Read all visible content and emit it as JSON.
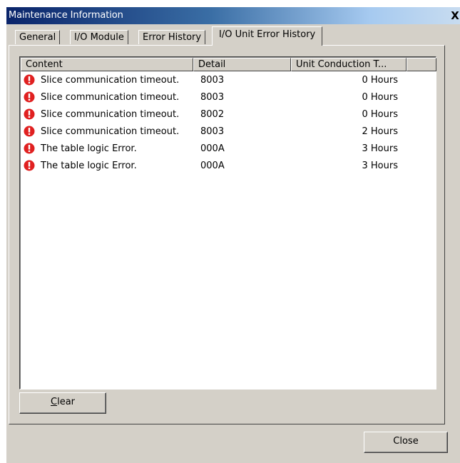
{
  "window": {
    "title": "Maintenance Information",
    "close_glyph": "X"
  },
  "tabs": [
    {
      "label": "General",
      "active": false
    },
    {
      "label": "I/O Module",
      "active": false
    },
    {
      "label": "Error History",
      "active": false
    },
    {
      "label": "I/O Unit Error History",
      "active": true
    }
  ],
  "table": {
    "columns": [
      "Content",
      "Detail",
      "Unit Conduction T..."
    ],
    "rows": [
      {
        "icon": "error-icon",
        "content": "Slice communication timeout.",
        "detail": "8003",
        "time": "0 Hours"
      },
      {
        "icon": "error-icon",
        "content": "Slice communication timeout.",
        "detail": "8003",
        "time": "0 Hours"
      },
      {
        "icon": "error-icon",
        "content": "Slice communication timeout.",
        "detail": "8002",
        "time": "0 Hours"
      },
      {
        "icon": "error-icon",
        "content": "Slice communication timeout.",
        "detail": "8003",
        "time": "2 Hours"
      },
      {
        "icon": "error-icon",
        "content": "The table logic Error.",
        "detail": "000A",
        "time": "3 Hours"
      },
      {
        "icon": "error-icon",
        "content": "The table logic Error.",
        "detail": "000A",
        "time": "3 Hours"
      }
    ]
  },
  "buttons": {
    "clear": {
      "mnemonic": "C",
      "rest": "lear"
    },
    "close": "Close"
  },
  "colors": {
    "dialog_bg": "#d4d0c8",
    "title_start": "#0a246a",
    "error_icon": "#e02020"
  }
}
